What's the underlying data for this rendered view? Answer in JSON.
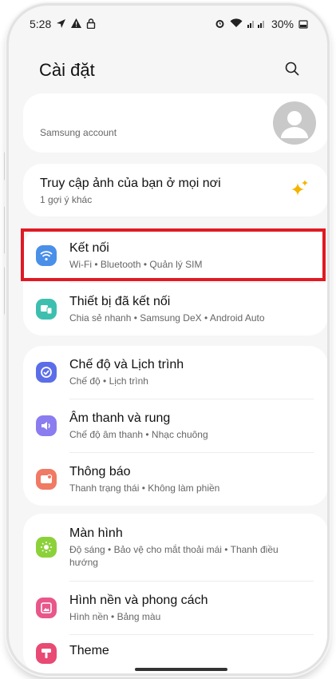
{
  "status": {
    "time": "5:28",
    "battery": "30%"
  },
  "header": {
    "title": "Cài đặt"
  },
  "account": {
    "label": "Samsung account"
  },
  "suggestion": {
    "title": "Truy cập ảnh của bạn ở mọi nơi",
    "subtitle": "1 gợi ý khác"
  },
  "groups": {
    "connections": [
      {
        "title": "Kết nối",
        "subtitle": "Wi-Fi • Bluetooth • Quản lý SIM",
        "icon": "wifi-icon",
        "color": "#4a8fe8"
      },
      {
        "title": "Thiết bị đã kết nối",
        "subtitle": "Chia sẻ nhanh • Samsung DeX • Android Auto",
        "icon": "connected-devices-icon",
        "color": "#3dbfb0"
      }
    ],
    "modes": [
      {
        "title": "Chế độ và Lịch trình",
        "subtitle": "Chế độ • Lịch trình",
        "icon": "modes-icon",
        "color": "#5b6ee8"
      },
      {
        "title": "Âm thanh và rung",
        "subtitle": "Chế độ âm thanh • Nhạc chuông",
        "icon": "sound-icon",
        "color": "#8b7cf0"
      },
      {
        "title": "Thông báo",
        "subtitle": "Thanh trạng thái • Không làm phiền",
        "icon": "notification-icon",
        "color": "#f07a64"
      }
    ],
    "display": [
      {
        "title": "Màn hình",
        "subtitle": "Độ sáng • Bảo vệ cho mắt thoải mái • Thanh điều hướng",
        "icon": "display-icon",
        "color": "#8cd13a"
      },
      {
        "title": "Hình nền và phong cách",
        "subtitle": "Hình nền • Bảng màu",
        "icon": "wallpaper-icon",
        "color": "#e8568a"
      },
      {
        "title": "Theme",
        "subtitle": "",
        "icon": "theme-icon",
        "color": "#e84a74"
      }
    ]
  }
}
